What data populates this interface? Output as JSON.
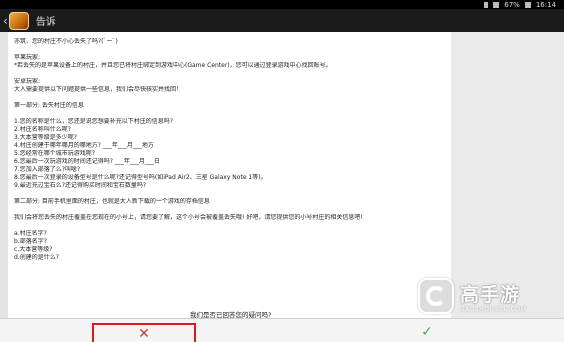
{
  "status_bar": {
    "time": "16:14",
    "battery": "67%",
    "icons": [
      "bluetooth-icon",
      "wifi-icon",
      "battery-icon"
    ]
  },
  "title_bar": {
    "title": "告诉"
  },
  "content": {
    "lines": [
      "亦筑、您的村庄不小心丢失了吗?(ﾟーﾟ)",
      "",
      "苹果玩家:",
      "*若丢失的是苹果设备上的村庄，并且您已将村庄绑定到游戏中心(Game Center)，您可以通过登录游戏中心找回账号。",
      "",
      "安卓玩家:",
      "大人需要提供以下问题提供一些信息，我们会尽快核实并找回！",
      "",
      "第一部分: 丢失村庄的信息",
      "",
      "1.您的名称是什么，您还是说您想要补充以下村庄的信息吗?",
      "2.村庄名称叫什么呢?",
      "3.大本营等级是多少呢?",
      "4.村庄创建于哪年哪月的哪地方? ___年___月___地方",
      "5.您经常在哪个城市玩游戏呢?",
      "6.您最后一次玩游戏的时间还记得吗? ___年___月___日",
      "7.您加入部落了么?叫啥?",
      "8.您最后一次登录的设备型号是什么呢?还记得型号吗(如iPad Air2、三星 Galaxy Note 1等)。",
      "9.最近充过宝石么?还记得购买时间和宝石数量吗?",
      "",
      "第二部分: 目前手机里面的村庄，也就是大人新下载的一个游戏的存档信息",
      "",
      "我们会将您丢失的村庄覆盖在您现在的小号上，请您要了解，这个小号会被覆盖丢失哦! 好吧，请您提供您的小号村庄的相关信息吧!",
      "",
      "a.村庄名字?",
      "b.部落名字?",
      "c.大本营等级?",
      "d.创建的是什么?"
    ]
  },
  "dialog": {
    "question": "我们是否已回答您的疑问吗?",
    "no_label": "✕",
    "yes_label": "✓"
  },
  "watermark": {
    "brand": "高手游",
    "domain": "GAOSHOUYOU.COM"
  }
}
